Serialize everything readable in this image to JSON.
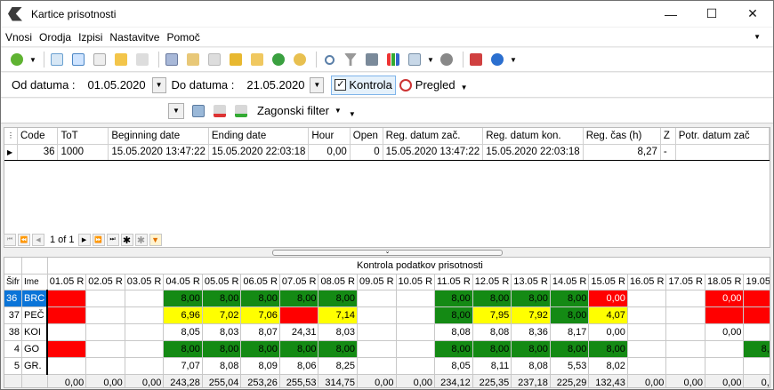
{
  "window": {
    "title": "Kartice prisotnosti"
  },
  "menu": [
    "Vnosi",
    "Orodja",
    "Izpisi",
    "Nastavitve",
    "Pomoč"
  ],
  "filter": {
    "od_label": "Od datuma :",
    "od_value": "01.05.2020",
    "do_label": "Do datuma :",
    "do_value": "21.05.2020",
    "kontrola": "Kontrola",
    "pregled": "Pregled",
    "zagonski": "Zagonski filter"
  },
  "grid1": {
    "columns": [
      "Code",
      "ToT",
      "Beginning date",
      "Ending date",
      "Hour",
      "Open",
      "Reg. datum zač.",
      "Reg. datum kon.",
      "Reg. čas (h)",
      "Z",
      "Potr. datum zač"
    ],
    "row": [
      "36",
      "1000",
      "15.05.2020 13:47:22",
      "15.05.2020 22:03:18",
      "0,00",
      "0",
      "15.05.2020 13:47:22",
      "15.05.2020 22:03:18",
      "8,27",
      "-",
      ""
    ],
    "pager": "1 of 1"
  },
  "grid2": {
    "title": "Kontrola podatkov prisotnosti",
    "col_sifra": "Šifr",
    "col_ime": "Ime",
    "dates": [
      "01.05 R",
      "02.05 R",
      "03.05 R",
      "04.05 R",
      "05.05 R",
      "06.05 R",
      "07.05 R",
      "08.05 R",
      "09.05 R",
      "10.05 R",
      "11.05 R",
      "12.05 R",
      "13.05 R",
      "14.05 R",
      "15.05 R",
      "16.05 R",
      "17.05 R",
      "18.05 R",
      "19.05 R",
      "2"
    ],
    "rows": [
      {
        "sifra": "36",
        "ime": "BRC",
        "cells": [
          [
            "",
            "r"
          ],
          [
            "",
            ""
          ],
          [
            "",
            ""
          ],
          [
            "8,00",
            "g"
          ],
          [
            "8,00",
            "g"
          ],
          [
            "8,00",
            "g"
          ],
          [
            "8,00",
            "g"
          ],
          [
            "8,00",
            "g"
          ],
          [
            "",
            ""
          ],
          [
            "",
            ""
          ],
          [
            "8,00",
            "g"
          ],
          [
            "8,00",
            "g"
          ],
          [
            "8,00",
            "g"
          ],
          [
            "8,00",
            "g"
          ],
          [
            "0,00",
            "r"
          ],
          [
            "",
            ""
          ],
          [
            "",
            ""
          ],
          [
            "0,00",
            "r"
          ],
          [
            "",
            "r"
          ],
          [
            "",
            "r"
          ]
        ]
      },
      {
        "sifra": "37",
        "ime": "PEČ",
        "cells": [
          [
            "",
            "r"
          ],
          [
            "",
            ""
          ],
          [
            "",
            ""
          ],
          [
            "6,96",
            "y"
          ],
          [
            "7,02",
            "y"
          ],
          [
            "7,06",
            "y"
          ],
          [
            "",
            "r"
          ],
          [
            "7,14",
            "y"
          ],
          [
            "",
            ""
          ],
          [
            "",
            ""
          ],
          [
            "8,00",
            "g"
          ],
          [
            "7,95",
            "y"
          ],
          [
            "7,92",
            "y"
          ],
          [
            "8,00",
            "g"
          ],
          [
            "4,07",
            "y"
          ],
          [
            "",
            ""
          ],
          [
            "",
            ""
          ],
          [
            "",
            "r"
          ],
          [
            "",
            "r"
          ],
          [
            "",
            "r"
          ]
        ]
      },
      {
        "sifra": "38",
        "ime": "KOI",
        "cells": [
          [
            "",
            ""
          ],
          [
            "",
            ""
          ],
          [
            "",
            ""
          ],
          [
            "8,05",
            ""
          ],
          [
            "8,03",
            ""
          ],
          [
            "8,07",
            ""
          ],
          [
            "24,31",
            ""
          ],
          [
            "8,03",
            ""
          ],
          [
            "",
            ""
          ],
          [
            "",
            ""
          ],
          [
            "8,08",
            ""
          ],
          [
            "8,08",
            ""
          ],
          [
            "8,36",
            ""
          ],
          [
            "8,17",
            ""
          ],
          [
            "0,00",
            ""
          ],
          [
            "",
            ""
          ],
          [
            "",
            ""
          ],
          [
            "0,00",
            ""
          ],
          [
            "",
            ""
          ],
          [
            "",
            ""
          ]
        ]
      },
      {
        "sifra": "4",
        "ime": "GO",
        "cells": [
          [
            "",
            "r"
          ],
          [
            "",
            ""
          ],
          [
            "",
            ""
          ],
          [
            "8,00",
            "g"
          ],
          [
            "8,00",
            "g"
          ],
          [
            "8,00",
            "g"
          ],
          [
            "8,00",
            "g"
          ],
          [
            "8,00",
            "g"
          ],
          [
            "",
            ""
          ],
          [
            "",
            ""
          ],
          [
            "8,00",
            "g"
          ],
          [
            "8,00",
            "g"
          ],
          [
            "8,00",
            "g"
          ],
          [
            "8,00",
            "g"
          ],
          [
            "8,00",
            "g"
          ],
          [
            "",
            ""
          ],
          [
            "",
            ""
          ],
          [
            "",
            ""
          ],
          [
            "8,00",
            "g"
          ],
          [
            "",
            "r"
          ]
        ]
      },
      {
        "sifra": "5",
        "ime": "GR.",
        "cells": [
          [
            "",
            ""
          ],
          [
            "",
            ""
          ],
          [
            "",
            ""
          ],
          [
            "7,07",
            ""
          ],
          [
            "8,08",
            ""
          ],
          [
            "8,09",
            ""
          ],
          [
            "8,06",
            ""
          ],
          [
            "8,25",
            ""
          ],
          [
            "",
            ""
          ],
          [
            "",
            ""
          ],
          [
            "8,05",
            ""
          ],
          [
            "8,11",
            ""
          ],
          [
            "8,08",
            ""
          ],
          [
            "5,53",
            ""
          ],
          [
            "8,02",
            ""
          ],
          [
            "",
            ""
          ],
          [
            "",
            ""
          ],
          [
            "",
            ""
          ],
          [
            "",
            ""
          ],
          [
            "",
            ""
          ]
        ]
      }
    ],
    "totals": [
      "0,00",
      "0,00",
      "0,00",
      "243,28",
      "255,04",
      "253,26",
      "255,53",
      "314,75",
      "0,00",
      "0,00",
      "234,12",
      "225,35",
      "237,18",
      "225,29",
      "132,43",
      "0,00",
      "0,00",
      "0,00",
      "0,00",
      ""
    ]
  }
}
